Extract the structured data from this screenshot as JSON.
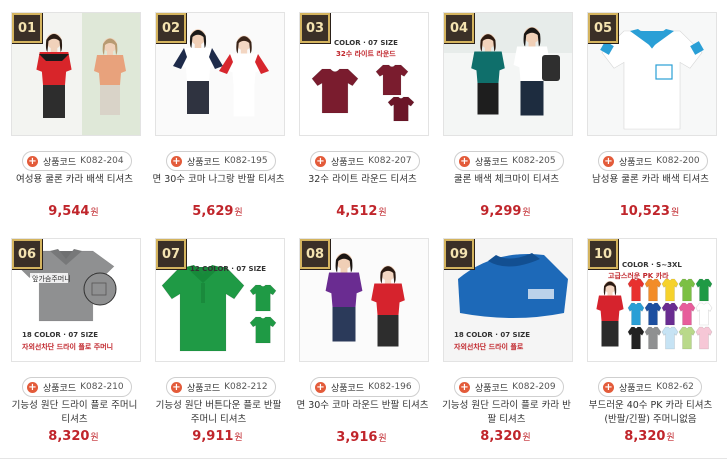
{
  "products": [
    {
      "rank": "01",
      "code_label": "상품코드",
      "code": "K082-204",
      "title": "여성용 쿨론 카라 배색 티셔츠",
      "price": "9,544",
      "won": "원",
      "image_desc": "red-peach-polo-woman"
    },
    {
      "rank": "02",
      "code_label": "상품코드",
      "code": "K082-195",
      "title": "면 30수 코마 나그랑 반팔 티셔츠",
      "price": "5,629",
      "won": "원",
      "image_desc": "raglan-couple"
    },
    {
      "rank": "03",
      "code_label": "상품코드",
      "code": "K082-207",
      "title": "32수 라이트 라운드 티셔츠",
      "price": "4,512",
      "won": "원",
      "image_desc": "burgundy-tshirt",
      "banner_color": "COLOR · 07 SIZE",
      "banner_sub": "32수 라이트 라운드"
    },
    {
      "rank": "04",
      "code_label": "상품코드",
      "code": "K082-205",
      "title": "쿨론 배색 체크마이 티셔츠",
      "price": "9,299",
      "won": "원",
      "image_desc": "teal-white-couple"
    },
    {
      "rank": "05",
      "code_label": "상품코드",
      "code": "K082-200",
      "title": "남성용 쿨론 카라 배색 티셔츠",
      "price": "10,523",
      "won": "원",
      "image_desc": "white-polo-blue-collar"
    },
    {
      "rank": "06",
      "code_label": "상품코드",
      "code": "K082-210",
      "title": "기능성 원단 드라이 플로 주머니 티셔츠",
      "price": "8,320",
      "won": "원",
      "image_desc": "grey-pocket-polo",
      "banner_color": "18 COLOR · 07 SIZE",
      "banner_sub": "자외선차단 드라이 플로 주머니",
      "tag": "앞가슴주머니"
    },
    {
      "rank": "07",
      "code_label": "상품코드",
      "code": "K082-212",
      "title": "기능성 원단 버튼다운 플로 반팔 주머니 티셔츠",
      "price": "9,911",
      "won": "원",
      "image_desc": "green-polo",
      "banner_color": "12 COLOR · 07 SIZE"
    },
    {
      "rank": "08",
      "code_label": "상품코드",
      "code": "K082-196",
      "title": "면 30수 코마 라운드 반팔 티셔츠",
      "price": "3,916",
      "won": "원",
      "image_desc": "purple-red-couple"
    },
    {
      "rank": "09",
      "code_label": "상품코드",
      "code": "K082-209",
      "title": "기능성 원단 드라이 플로 카라 반팔 티셔츠",
      "price": "8,320",
      "won": "원",
      "image_desc": "blue-polo",
      "banner_color": "18 COLOR · 07 SIZE",
      "banner_sub": "자외선차단 드라이 플로"
    },
    {
      "rank": "10",
      "code_label": "상품코드",
      "code": "K082-62",
      "title": "부드러운 40수 PK 카라 티셔츠 (반팔/긴팔) 주머니없음",
      "price": "8,320",
      "won": "원",
      "image_desc": "multicolor-polos",
      "banner_color": "COLOR · S~3XL",
      "banner_sub": "고급스러운 PK 카라"
    }
  ],
  "colors": {
    "price": "#c0252b",
    "badge_bg": "#3b3027",
    "badge_border": "#d4b45f",
    "plus": "#e35b3a"
  }
}
